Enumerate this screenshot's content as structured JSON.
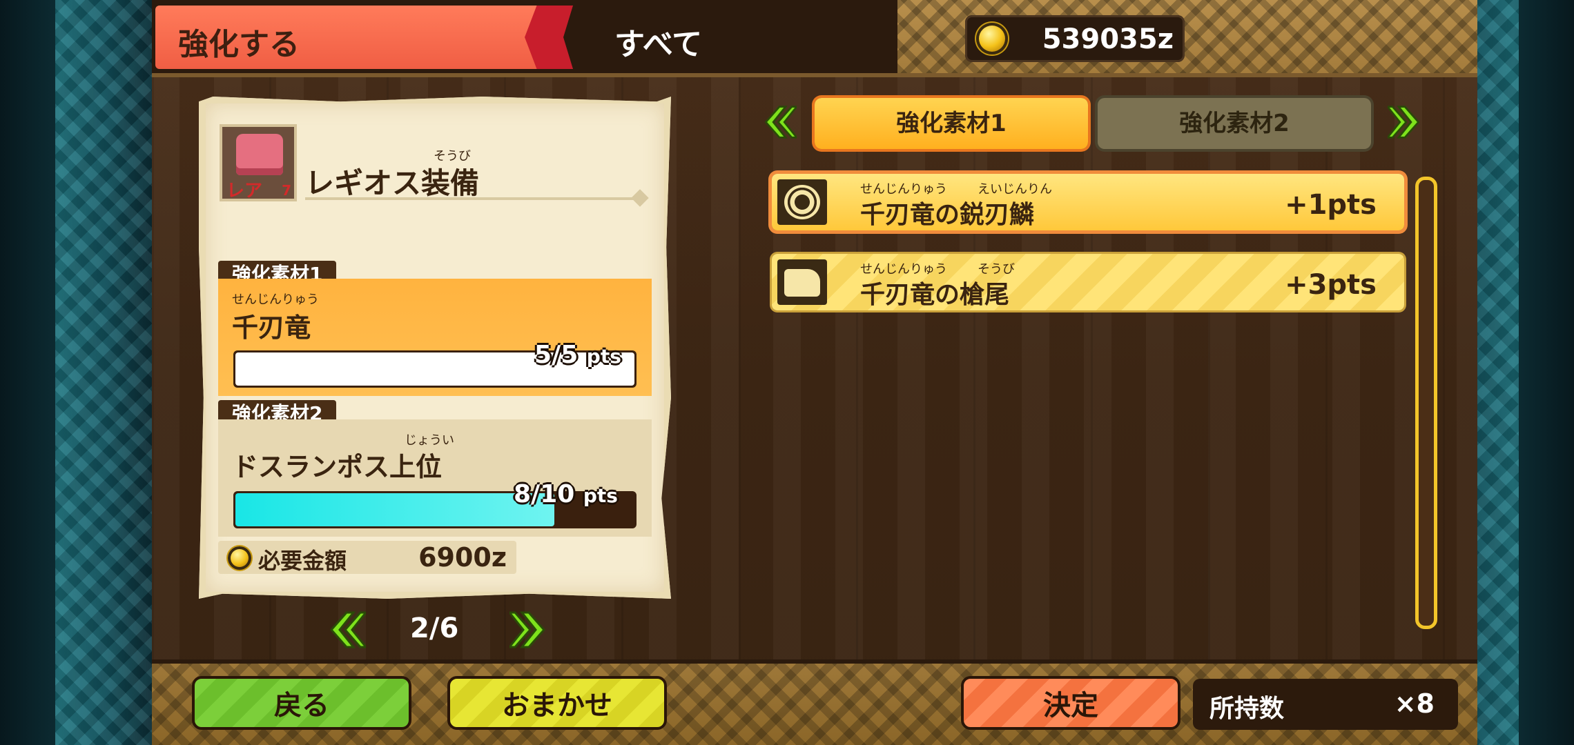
{
  "header": {
    "tab_label": "強化する",
    "filter_label": "すべて",
    "money": "539035z"
  },
  "item": {
    "name": "レギオス装備",
    "name_ruby": "そうび",
    "rarity_label": "レア",
    "rarity_num": "7"
  },
  "materials": [
    {
      "tag": "強化素材1",
      "ruby": "せんじんりゅう",
      "name": "千刃竜",
      "progress_text": "5/5",
      "progress_unit": "pts",
      "progress": 1.0
    },
    {
      "tag": "強化素材2",
      "ruby": "じょうい",
      "name": "ドスランポス上位",
      "progress_text": "8/10",
      "progress_unit": "pts",
      "progress": 0.8
    }
  ],
  "cost": {
    "label": "必要金額",
    "value": "6900z"
  },
  "pager": {
    "text": "2/6"
  },
  "material_tabs": {
    "tab1": "強化素材1",
    "tab2": "強化素材2"
  },
  "list": [
    {
      "ruby1": "せんじんりゅう",
      "ruby2": "えいじんりん",
      "name": "千刃竜の鋭刃鱗",
      "pts": "+1pts",
      "icon": "scale-icon"
    },
    {
      "ruby1": "せんじんりゅう",
      "ruby2": "そうび",
      "name": "千刃竜の槍尾",
      "pts": "+3pts",
      "icon": "tail-icon"
    }
  ],
  "buttons": {
    "back": "戻る",
    "auto": "おまかせ",
    "ok": "決定"
  },
  "stock": {
    "label": "所持数",
    "value": "×8"
  },
  "colors": {
    "accent_orange": "#ffb33f",
    "gauge_cyan": "#19e6e6",
    "tab_red": "#f05e44"
  }
}
